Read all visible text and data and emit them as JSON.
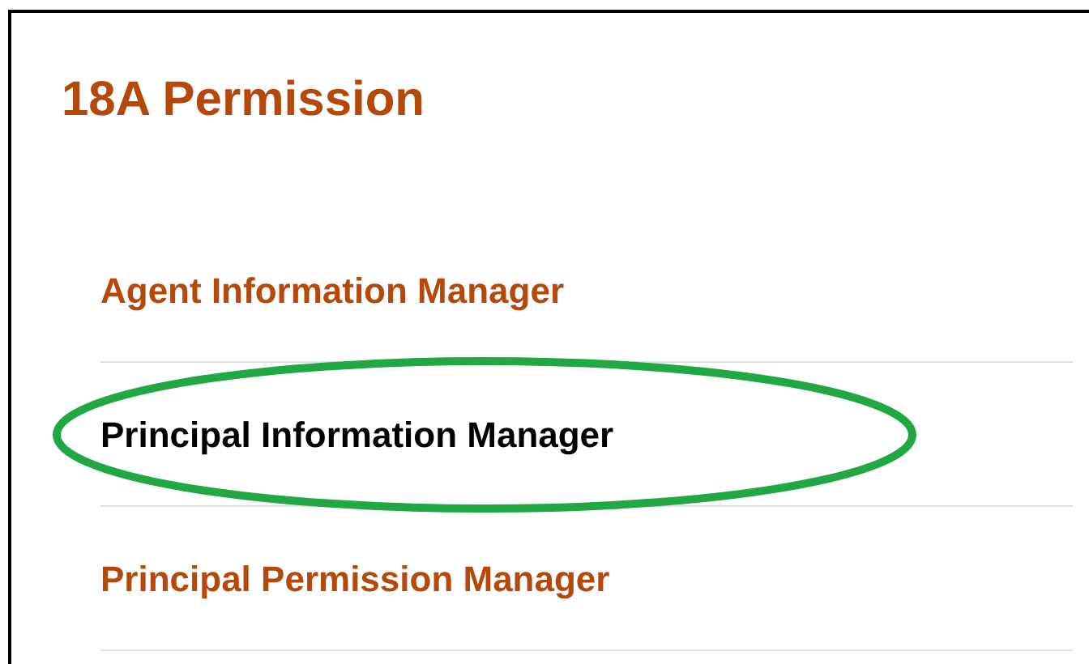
{
  "title": "18A Permission",
  "items": [
    {
      "label": "Agent Information Manager",
      "selected": false,
      "circled": false
    },
    {
      "label": "Principal Information Manager",
      "selected": true,
      "circled": true
    },
    {
      "label": "Principal Permission Manager",
      "selected": false,
      "circled": false
    }
  ]
}
